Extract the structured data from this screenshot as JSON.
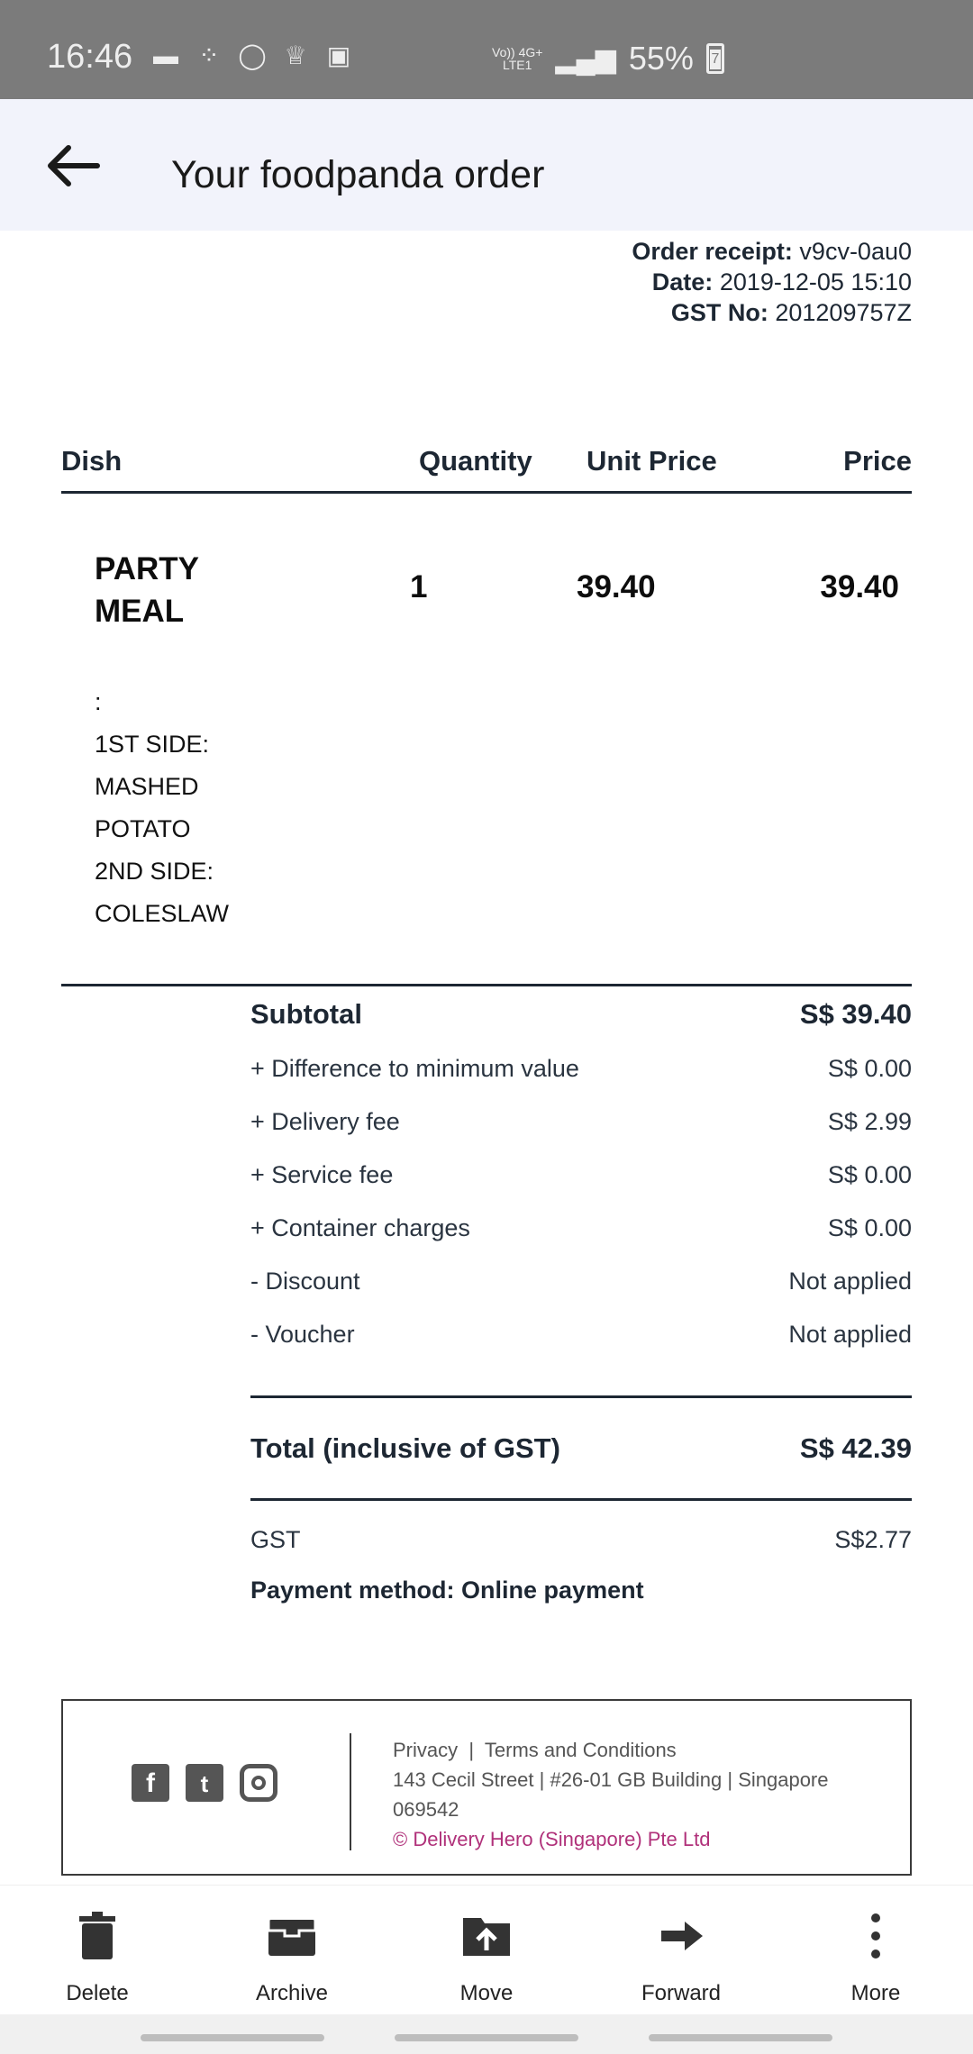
{
  "status_bar": {
    "time": "16:46",
    "network_top": "Vo)) 4G+",
    "network_bottom": "LTE1",
    "battery": "55%",
    "icons": [
      "message-icon",
      "grid-icon",
      "whatsapp-icon",
      "gift-icon",
      "gallery-icon"
    ]
  },
  "app_bar": {
    "title": "Your foodpanda order"
  },
  "receipt": {
    "order_label": "Order receipt:",
    "order_value": "v9cv-0au0",
    "date_label": "Date:",
    "date_value": "2019-12-05 15:10",
    "gst_label": "GST No:",
    "gst_value": "201209757Z"
  },
  "table": {
    "headers": {
      "dish": "Dish",
      "quantity": "Quantity",
      "unit_price": "Unit Price",
      "price": "Price"
    },
    "item": {
      "name": "PARTY MEAL",
      "quantity": "1",
      "unit_price": "39.40",
      "price": "39.40",
      "options": [
        ":",
        "1ST SIDE:",
        "MASHED",
        "POTATO",
        "2ND SIDE:",
        "COLESLAW"
      ]
    }
  },
  "summary": {
    "subtotal_label": "Subtotal",
    "subtotal_value": "S$ 39.40",
    "rows": [
      {
        "label": "+ Difference to minimum value",
        "value": "S$ 0.00"
      },
      {
        "label": "+ Delivery fee",
        "value": "S$ 2.99"
      },
      {
        "label": "+ Service fee",
        "value": "S$ 0.00"
      },
      {
        "label": "+ Container charges",
        "value": "S$ 0.00"
      },
      {
        "label": "- Discount",
        "value": "Not applied"
      },
      {
        "label": "- Voucher",
        "value": "Not applied"
      }
    ],
    "total_label": "Total (inclusive of GST)",
    "total_value": "S$ 42.39",
    "gst_label": "GST",
    "gst_value": "S$2.77",
    "payment": "Payment method: Online payment"
  },
  "footer": {
    "privacy": "Privacy",
    "separator": "|",
    "terms": "Terms and Conditions",
    "address": "143 Cecil Street | #26-01 GB Building | Singapore 069542",
    "copyright": "© Delivery Hero (Singapore) Pte Ltd"
  },
  "bottom_actions": [
    {
      "label": "Delete",
      "icon": "trash-icon"
    },
    {
      "label": "Archive",
      "icon": "archive-icon"
    },
    {
      "label": "Move",
      "icon": "move-folder-icon"
    },
    {
      "label": "Forward",
      "icon": "forward-icon"
    },
    {
      "label": "More",
      "icon": "more-vertical-icon"
    }
  ]
}
